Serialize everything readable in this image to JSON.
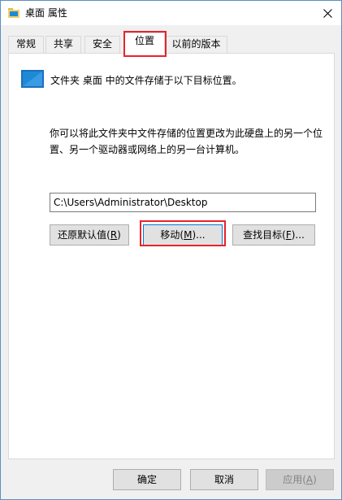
{
  "window": {
    "title": "桌面 属性",
    "close_icon": "close-icon"
  },
  "tabs": [
    {
      "label": "常规"
    },
    {
      "label": "共享"
    },
    {
      "label": "安全"
    },
    {
      "label": "位置",
      "active": true
    },
    {
      "label": "以前的版本"
    }
  ],
  "location": {
    "description": "文件夹 桌面 中的文件存储于以下目标位置。",
    "info": "你可以将此文件夹中文件存储的位置更改为此硬盘上的另一个位置、另一个驱动器或网络上的另一台计算机。",
    "path": "C:\\Users\\Administrator\\Desktop",
    "restore_label": "还原默认值(",
    "restore_key": "R",
    "move_label": "移动(",
    "move_key": "M",
    "move_suffix": ")...",
    "find_label": "查找目标(",
    "find_key": "F",
    "find_suffix": ")..."
  },
  "footer": {
    "ok_label": "确定",
    "cancel_label": "取消",
    "apply_label": "应用(",
    "apply_key": "A",
    "close_paren": ")"
  },
  "colors": {
    "highlight": "#e8232a",
    "focus": "#0078d7"
  }
}
